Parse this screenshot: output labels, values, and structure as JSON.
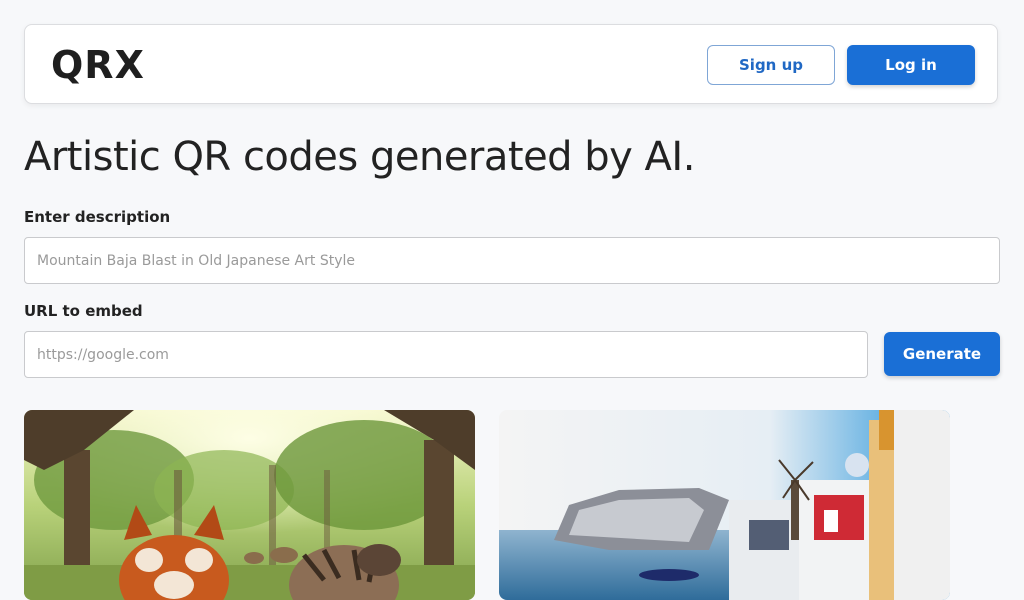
{
  "header": {
    "logo": "QRX",
    "signup_label": "Sign up",
    "login_label": "Log in"
  },
  "hero": {
    "title": "Artistic QR codes generated by AI."
  },
  "form": {
    "description_label": "Enter description",
    "description_placeholder": "Mountain Baja Blast in Old Japanese Art Style",
    "url_label": "URL to embed",
    "url_placeholder": "https://google.com",
    "generate_label": "Generate"
  },
  "gallery": [
    {
      "subject": "forest-animals-artwork"
    },
    {
      "subject": "coastal-village-artwork"
    }
  ],
  "colors": {
    "primary": "#1a6fd6",
    "background": "#f7f8fa"
  }
}
